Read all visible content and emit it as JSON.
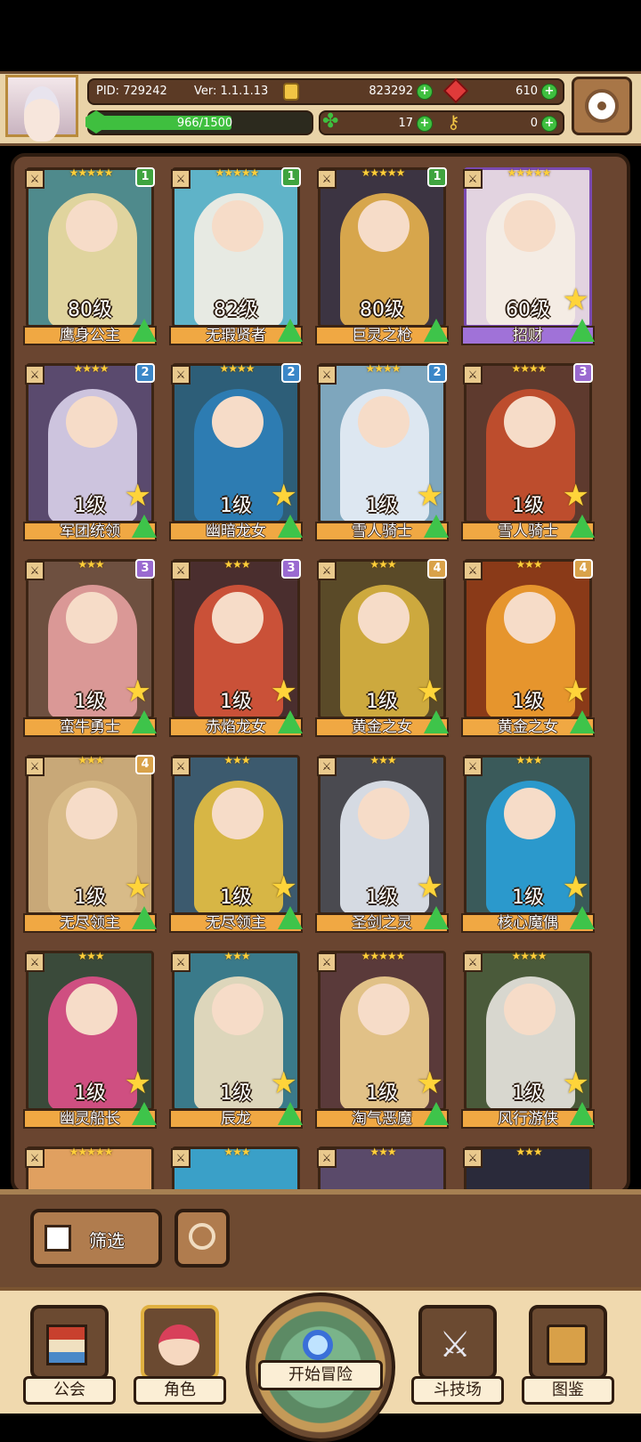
{
  "header": {
    "pid_label": "PID: 729242",
    "version_label": "Ver: 1.1.1.13",
    "gold": "823292",
    "gems": "610",
    "exp": "966/1500",
    "exp_fraction": 0.644,
    "clover": "17",
    "keys": "0"
  },
  "colors": {
    "badge_green": "#3fa43f",
    "badge_blue": "#3b87c8",
    "badge_purple": "#9a6ad0",
    "badge_orange": "#d9a24a"
  },
  "cards": [
    {
      "name": "鹰身公主",
      "level": "80级",
      "stars": "★★★★★",
      "badge": "1",
      "badgeColor": "#3fa43f",
      "art": "#4f8a8c",
      "hair": "#f0dca0",
      "purple": false,
      "showStar": false
    },
    {
      "name": "无瑕贤者",
      "level": "82级",
      "stars": "★★★★★",
      "badge": "1",
      "badgeColor": "#3fa43f",
      "art": "#5fb3c8",
      "hair": "#f6efe6",
      "purple": false,
      "showStar": false
    },
    {
      "name": "巨灵之枪",
      "level": "80级",
      "stars": "★★★★★",
      "badge": "1",
      "badgeColor": "#3fa43f",
      "art": "#3c3442",
      "hair": "#e8b24e",
      "purple": false,
      "showStar": false
    },
    {
      "name": "招财",
      "level": "60级",
      "stars": "★★★★★",
      "badge": "",
      "badgeColor": "",
      "art": "#e2d3e0",
      "hair": "#f6eee4",
      "purple": true,
      "showStar": true
    },
    {
      "name": "军团统领",
      "level": "1级",
      "stars": "★★★★",
      "badge": "2",
      "badgeColor": "#3b87c8",
      "art": "#5a4a6e",
      "hair": "#d9d2ea",
      "purple": false,
      "showStar": true
    },
    {
      "name": "幽暗龙女",
      "level": "1级",
      "stars": "★★★★",
      "badge": "2",
      "badgeColor": "#3b87c8",
      "art": "#2d5e78",
      "hair": "#2e7fb8",
      "purple": false,
      "showStar": true
    },
    {
      "name": "雪人骑士",
      "level": "1级",
      "stars": "★★★★",
      "badge": "2",
      "badgeColor": "#3b87c8",
      "art": "#7ea6bd",
      "hair": "#e8eef6",
      "purple": false,
      "showStar": true
    },
    {
      "name": "雪人骑士",
      "level": "1级",
      "stars": "★★★★",
      "badge": "3",
      "badgeColor": "#9a6ad0",
      "art": "#5e3a2e",
      "hair": "#c8502e",
      "purple": false,
      "showStar": true
    },
    {
      "name": "蛮牛勇士",
      "level": "1级",
      "stars": "★★★",
      "badge": "3",
      "badgeColor": "#9a6ad0",
      "art": "#6e5040",
      "hair": "#e6a0a0",
      "purple": false,
      "showStar": true
    },
    {
      "name": "赤焰龙女",
      "level": "1级",
      "stars": "★★★",
      "badge": "3",
      "badgeColor": "#9a6ad0",
      "art": "#4a2e2e",
      "hair": "#d8553a",
      "purple": false,
      "showStar": true
    },
    {
      "name": "黄金之女",
      "level": "1级",
      "stars": "★★★",
      "badge": "4",
      "badgeColor": "#d9a24a",
      "art": "#5a4a28",
      "hair": "#d9b440",
      "purple": false,
      "showStar": true
    },
    {
      "name": "黄金之女",
      "level": "1级",
      "stars": "★★★",
      "badge": "4",
      "badgeColor": "#d9a24a",
      "art": "#8a3a18",
      "hair": "#f0a030",
      "purple": false,
      "showStar": true
    },
    {
      "name": "无尽领主",
      "level": "1级",
      "stars": "★★★",
      "badge": "4",
      "badgeColor": "#d9a24a",
      "art": "#c8a878",
      "hair": "#d9bd8a",
      "purple": false,
      "showStar": true
    },
    {
      "name": "无尽领主",
      "level": "1级",
      "stars": "★★★",
      "badge": "",
      "badgeColor": "",
      "art": "#3c5a6e",
      "hair": "#e8c040",
      "purple": false,
      "showStar": true
    },
    {
      "name": "圣剑之灵",
      "level": "1级",
      "stars": "★★★",
      "badge": "",
      "badgeColor": "",
      "art": "#4a4a50",
      "hair": "#e4eaf2",
      "purple": false,
      "showStar": true
    },
    {
      "name": "核心魔偶",
      "level": "1级",
      "stars": "★★★",
      "badge": "",
      "badgeColor": "",
      "art": "#3a5a5a",
      "hair": "#2aa0d8",
      "purple": false,
      "showStar": true
    },
    {
      "name": "幽灵船长",
      "level": "1级",
      "stars": "★★★",
      "badge": "",
      "badgeColor": "",
      "art": "#3a4a3a",
      "hair": "#e0508a",
      "purple": false,
      "showStar": true
    },
    {
      "name": "辰龙",
      "level": "1级",
      "stars": "★★★",
      "badge": "",
      "badgeColor": "",
      "art": "#3a7a8a",
      "hair": "#f0e0c0",
      "purple": false,
      "showStar": true
    },
    {
      "name": "淘气恶魔",
      "level": "1级",
      "stars": "★★★★★",
      "badge": "",
      "badgeColor": "",
      "art": "#5a3a3a",
      "hair": "#f0d090",
      "purple": false,
      "showStar": true
    },
    {
      "name": "风行游侠",
      "level": "1级",
      "stars": "★★★★",
      "badge": "",
      "badgeColor": "",
      "art": "#4a5a3a",
      "hair": "#e8e4e0",
      "purple": false,
      "showStar": true
    }
  ],
  "partial_cards": [
    {
      "stars": "★★★★★",
      "art": "#e0a060"
    },
    {
      "stars": "★★★",
      "art": "#3aa0c8"
    },
    {
      "stars": "★★★",
      "art": "#5a4a6a"
    },
    {
      "stars": "★★★",
      "art": "#2a2a3a"
    }
  ],
  "filter": {
    "label": "筛选"
  },
  "nav": {
    "guild": "公会",
    "character": "角色",
    "adventure": "开始冒险",
    "arena": "斗技场",
    "codex": "图鉴"
  }
}
